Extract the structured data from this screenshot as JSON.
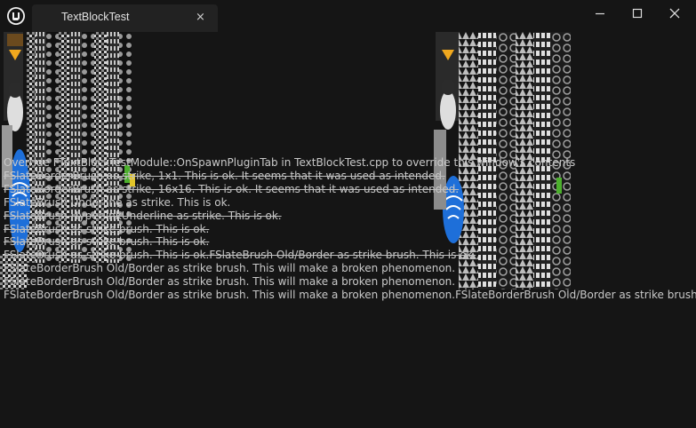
{
  "window": {
    "tab_title": "TextBlockTest",
    "close_tab_glyph": "×"
  },
  "icons": {
    "logo": "unreal-logo-icon",
    "minimize": "minimize-icon",
    "maximize": "maximize-icon",
    "close": "close-icon"
  },
  "text_lines": [
    "Override FTextBlockTestModule::OnSpawnPluginTab in TextBlockTest.cpp to override this window's contents",
    "FSlateBorderBrush as strike, 1x1. This is ok. It seems that it was used as intended.",
    "FSlateBorderBrush as strike, 16x16. This is ok. It seems that it was used as intended.",
    "FSlateBrush Underline as strike. This is ok.",
    "FSlateBrush HyperlinkUnderline as strike. This is ok.",
    "FSlateBrush as strike brush. This is ok.",
    "FSlateBrush as strike brush. This is ok.",
    "FSlateBrush as strike brush. This is ok.FSlateBrush Old/Border as strike brush. This is ok.",
    "FSlateBorderBrush Old/Border as strike brush. This will make a broken phenomenon.",
    "FSlateBorderBrush Old/Border as strike brush. This will make a broken phenomenon.",
    "FSlateBorderBrush Old/Border as strike brush. This will make a broken phenomenon.FSlateBorderBrush Old/Border as strike brush. This"
  ],
  "colors": {
    "background": "#151515",
    "tab": "#222222",
    "text": "#c9c9c9",
    "accent_blue": "#1e6fd9"
  }
}
